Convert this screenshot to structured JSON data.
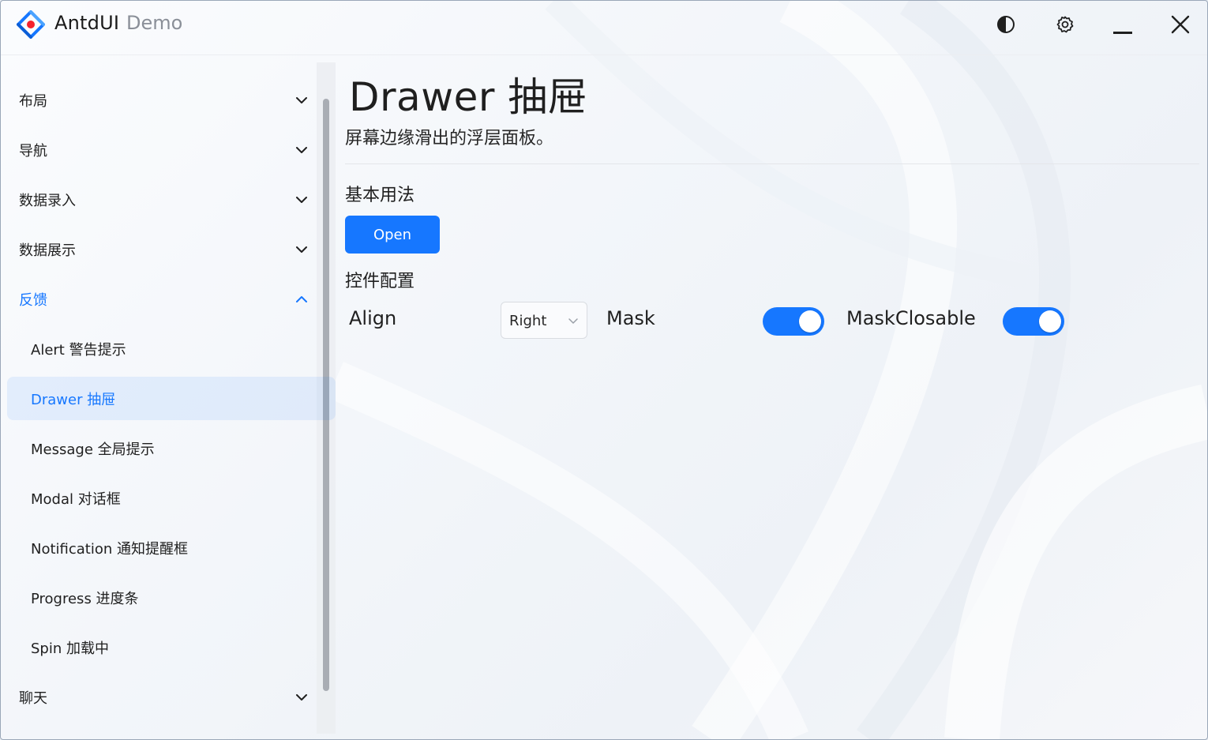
{
  "app": {
    "title": "AntdUI",
    "subtitle": "Demo"
  },
  "titlebar_icons": [
    "contrast-icon",
    "gear-icon",
    "minimize-icon",
    "close-icon"
  ],
  "sidebar": {
    "items": [
      {
        "label": "布局",
        "type": "group",
        "expanded": false
      },
      {
        "label": "导航",
        "type": "group",
        "expanded": false
      },
      {
        "label": "数据录入",
        "type": "group",
        "expanded": false
      },
      {
        "label": "数据展示",
        "type": "group",
        "expanded": false
      },
      {
        "label": "反馈",
        "type": "group",
        "expanded": true
      },
      {
        "label": "Alert 警告提示",
        "type": "item"
      },
      {
        "label": "Drawer 抽屉",
        "type": "item",
        "selected": true
      },
      {
        "label": "Message 全局提示",
        "type": "item"
      },
      {
        "label": "Modal 对话框",
        "type": "item"
      },
      {
        "label": "Notification 通知提醒框",
        "type": "item"
      },
      {
        "label": "Progress 进度条",
        "type": "item"
      },
      {
        "label": "Spin 加载中",
        "type": "item"
      },
      {
        "label": "聊天",
        "type": "group",
        "expanded": false
      }
    ]
  },
  "main": {
    "title": "Drawer 抽屉",
    "description": "屏幕边缘滑出的浮层面板。",
    "basic_section": "基本用法",
    "open_button": "Open",
    "config_section": "控件配置",
    "align_label": "Align",
    "align_value": "Right",
    "mask_label": "Mask",
    "mask_on": true,
    "mask_closable_label": "MaskClosable",
    "mask_closable_on": true
  },
  "colors": {
    "accent": "#1677ff",
    "selected_bg": "#e8f1ff"
  }
}
